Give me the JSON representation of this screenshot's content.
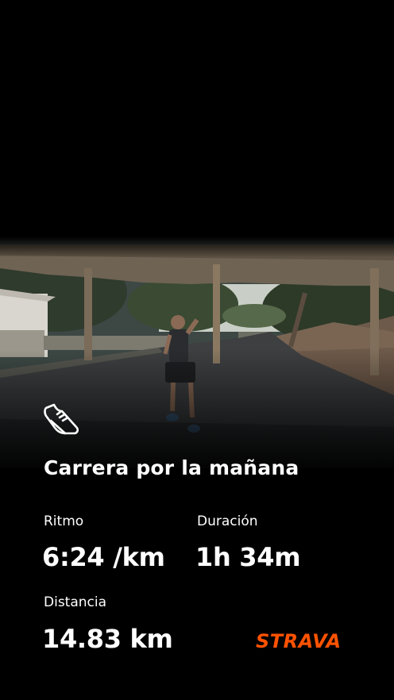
{
  "activity": {
    "title": "Carrera por la mañana",
    "icon": "running-shoe-icon"
  },
  "stats": {
    "pace_label": "Ritmo",
    "pace_value": "6:24 /km",
    "duration_label": "Duración",
    "duration_value": "1h 34m",
    "distance_label": "Distancia",
    "distance_value": "14.83 km"
  },
  "brand": {
    "name": "STRAVA",
    "color": "#fc5200"
  }
}
